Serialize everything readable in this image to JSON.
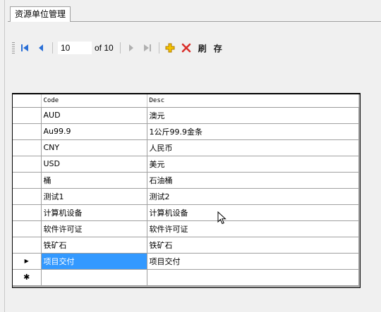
{
  "tab": {
    "title": "资源单位管理"
  },
  "navigator": {
    "position": "10",
    "count_label": "of 10",
    "refresh_label": "刷",
    "save_label": "存"
  },
  "grid": {
    "columns": [
      "Code",
      "Desc"
    ],
    "rows": [
      [
        "AUD",
        "澳元"
      ],
      [
        "Au99.9",
        "1公斤99.9金条"
      ],
      [
        "CNY",
        "人民币"
      ],
      [
        "USD",
        "美元"
      ],
      [
        "桶",
        "石油桶"
      ],
      [
        "测试1",
        "测试2"
      ],
      [
        "计算机设备",
        "计算机设备"
      ],
      [
        "软件许可证",
        "软件许可证"
      ],
      [
        "铁矿石",
        "铁矿石"
      ],
      [
        "项目交付",
        "项目交付"
      ]
    ],
    "current_row_marker": "▶",
    "new_row_marker": "✱"
  },
  "colors": {
    "selection": "#3399ff",
    "nav_blue": "#2a6fd6",
    "add": "#e8a800",
    "delete": "#d9302b"
  }
}
